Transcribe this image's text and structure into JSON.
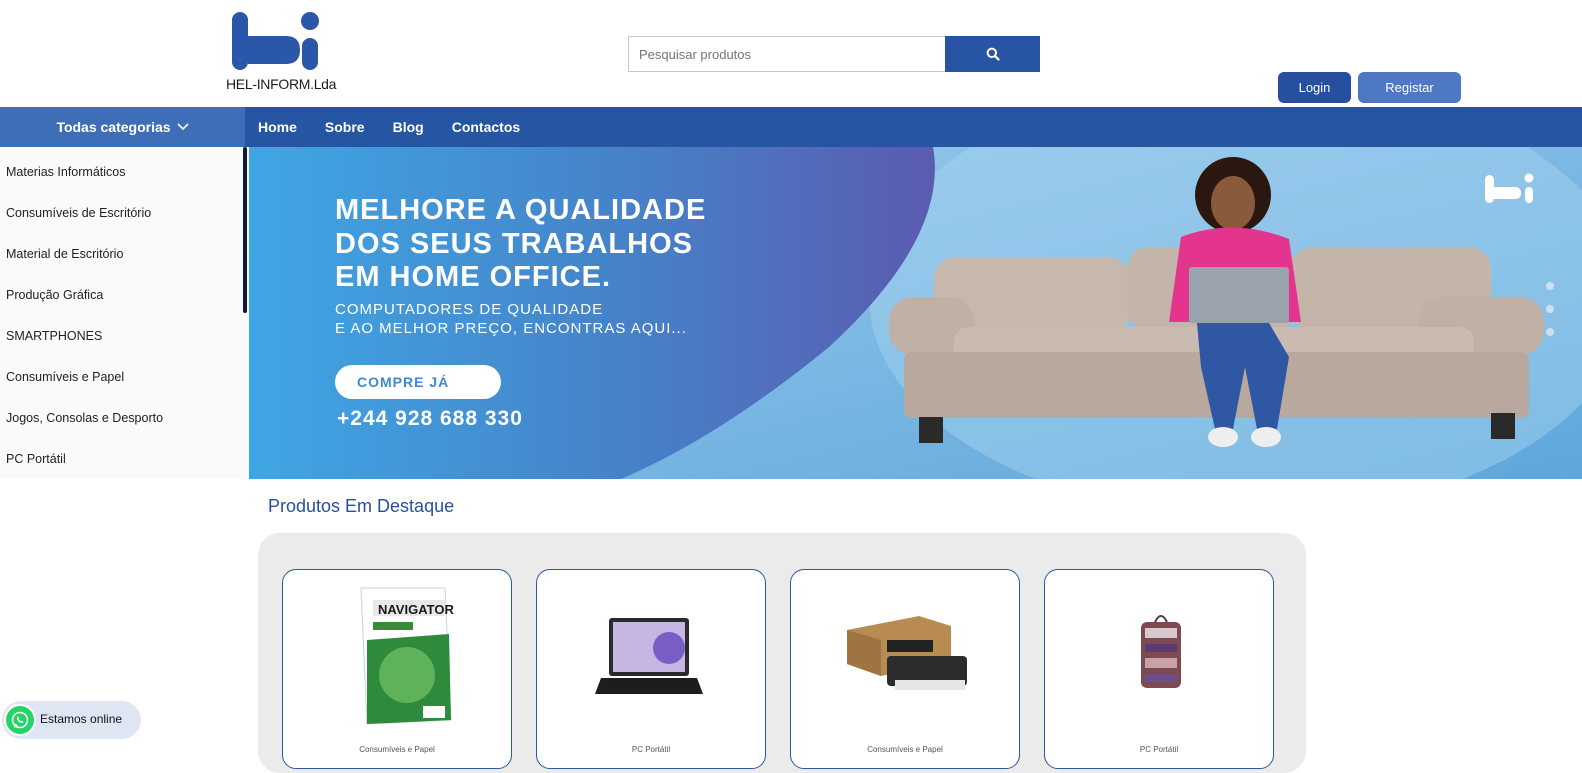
{
  "header": {
    "logo_text": "HEL-INFORM.Lda",
    "search_placeholder": "Pesquisar produtos",
    "login_label": "Login",
    "register_label": "Registar"
  },
  "nav": {
    "categories_label": "Todas categorias",
    "links": [
      "Home",
      "Sobre",
      "Blog",
      "Contactos"
    ]
  },
  "sidebar": {
    "categories": [
      "Materias Informáticos",
      "Consumíveis de Escritório",
      "Material de Escritório",
      "Produção Gráfica",
      "SMARTPHONES",
      "Consumíveis e Papel",
      "Jogos, Consolas e Desporto",
      "PC Portátil"
    ]
  },
  "banner": {
    "headline_1": "MELHORE A QUALIDADE",
    "headline_2": "DOS SEUS TRABALHOS",
    "headline_3": "EM HOME OFFICE.",
    "sub_1": "COMPUTADORES DE QUALIDADE",
    "sub_2": "E AO MELHOR PREÇO, ENCONTRAS AQUI...",
    "cta": "COMPRE JÁ",
    "phone": "+244 928 688 330",
    "slide_dots": 3
  },
  "featured": {
    "title": "Produtos Em Destaque",
    "products": [
      {
        "category": "Consumíveis e Papel",
        "image": "navigator-paper-ream"
      },
      {
        "category": "PC Portátil",
        "image": "laptop"
      },
      {
        "category": "Consumíveis e Papel",
        "image": "kyocera-toner-box"
      },
      {
        "category": "PC Portátil",
        "image": "patterned-bag"
      }
    ]
  },
  "chat": {
    "label": "Estamos online",
    "icon": "whatsapp-icon"
  },
  "colors": {
    "primary": "#2655a3",
    "accent": "#4f78c2",
    "whatsapp": "#25d366"
  }
}
